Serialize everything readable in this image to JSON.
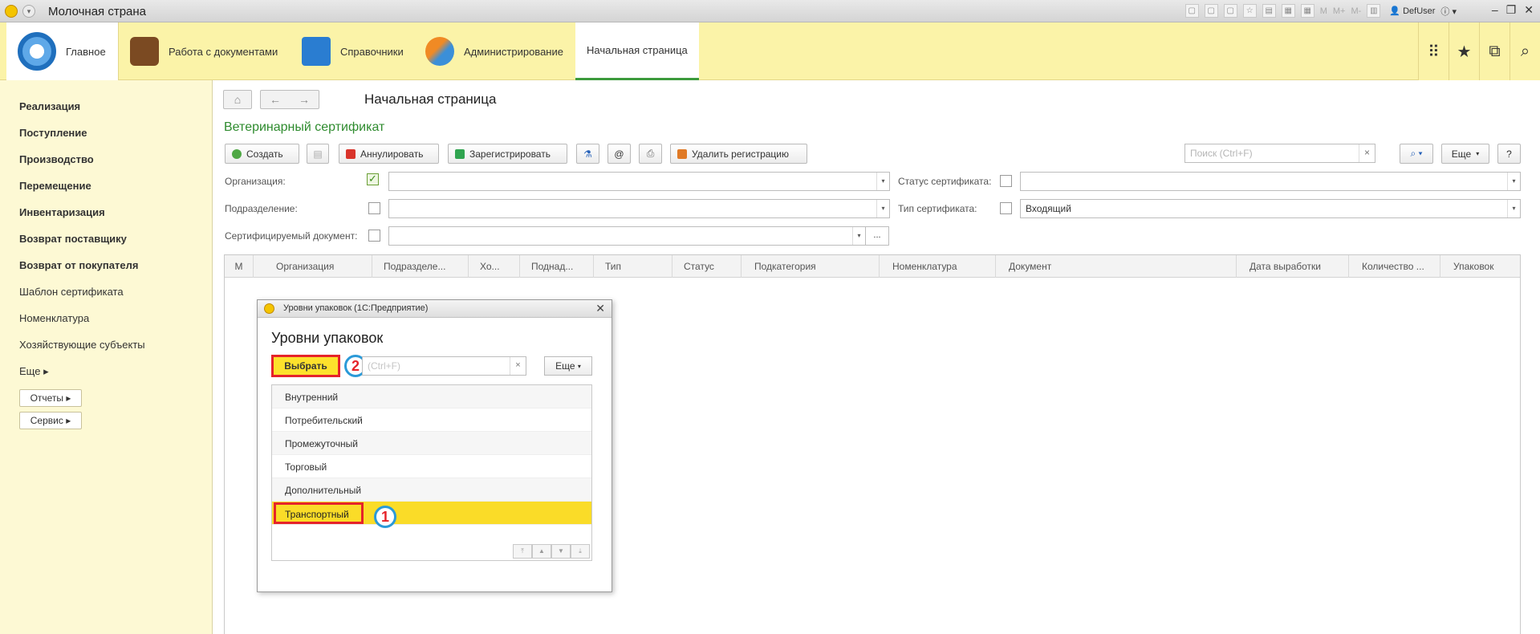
{
  "window": {
    "title": "Молочная страна",
    "user": "DefUser",
    "toolbar_text": [
      "M",
      "M+",
      "M-"
    ]
  },
  "sections": {
    "main": "Главное",
    "docs": "Работа с документами",
    "refs": "Справочники",
    "admin": "Администрирование",
    "home": "Начальная страница"
  },
  "sidebar": {
    "items": [
      {
        "label": "Реализация",
        "bold": true
      },
      {
        "label": "Поступление",
        "bold": true
      },
      {
        "label": "Производство",
        "bold": true
      },
      {
        "label": "Перемещение",
        "bold": true
      },
      {
        "label": "Инвентаризация",
        "bold": true
      },
      {
        "label": "Возврат поставщику",
        "bold": true
      },
      {
        "label": "Возврат от покупателя",
        "bold": true
      },
      {
        "label": "Шаблон сертификата",
        "bold": false
      },
      {
        "label": "Номенклатура",
        "bold": false
      },
      {
        "label": "Хозяйствующие субъекты",
        "bold": false
      },
      {
        "label": "Еще ▸",
        "bold": false
      }
    ],
    "reports_btn": "Отчеты ▸",
    "service_btn": "Сервис ▸"
  },
  "page": {
    "title": "Начальная страница",
    "form_title": "Ветеринарный сертификат"
  },
  "toolbar": {
    "create": "Создать",
    "cancel": "Аннулировать",
    "register": "Зарегистрировать",
    "at": "@",
    "delete_reg": "Удалить регистрацию",
    "search_placeholder": "Поиск (Ctrl+F)",
    "more": "Еще",
    "help": "?"
  },
  "filters": {
    "org_label": "Организация:",
    "dept_label": "Подразделение:",
    "doc_label": "Сертифицируемый документ:",
    "status_label": "Статус сертификата:",
    "type_label": "Тип сертификата:",
    "type_value": "Входящий",
    "org_checked": true
  },
  "grid": {
    "columns": [
      "М",
      "Организация",
      "Подразделе...",
      "Хо...",
      "Поднад...",
      "Тип",
      "Статус",
      "Подкатегория",
      "Номенклатура",
      "Документ",
      "Дата выработки",
      "Количество ...",
      "Упаковок"
    ]
  },
  "dialog": {
    "title": "Уровни упаковок  (1С:Предприятие)",
    "heading": "Уровни упаковок",
    "select_btn": "Выбрать",
    "search_placeholder": "(Ctrl+F)",
    "search_clear": "×",
    "more": "Еще",
    "items": [
      "Внутренний",
      "Потребительский",
      "Промежуточный",
      "Торговый",
      "Дополнительный",
      "Транспортный"
    ],
    "selected_index": 5,
    "marker_1": "1",
    "marker_2": "2"
  },
  "colors": {
    "section_bar": "#fbf3a8",
    "sidebar": "#fdf9d4",
    "form_title": "#2e8b2e",
    "highlight": "#fadc28",
    "annotation_red": "#e5232a",
    "annotation_blue": "#2b9ad8"
  }
}
